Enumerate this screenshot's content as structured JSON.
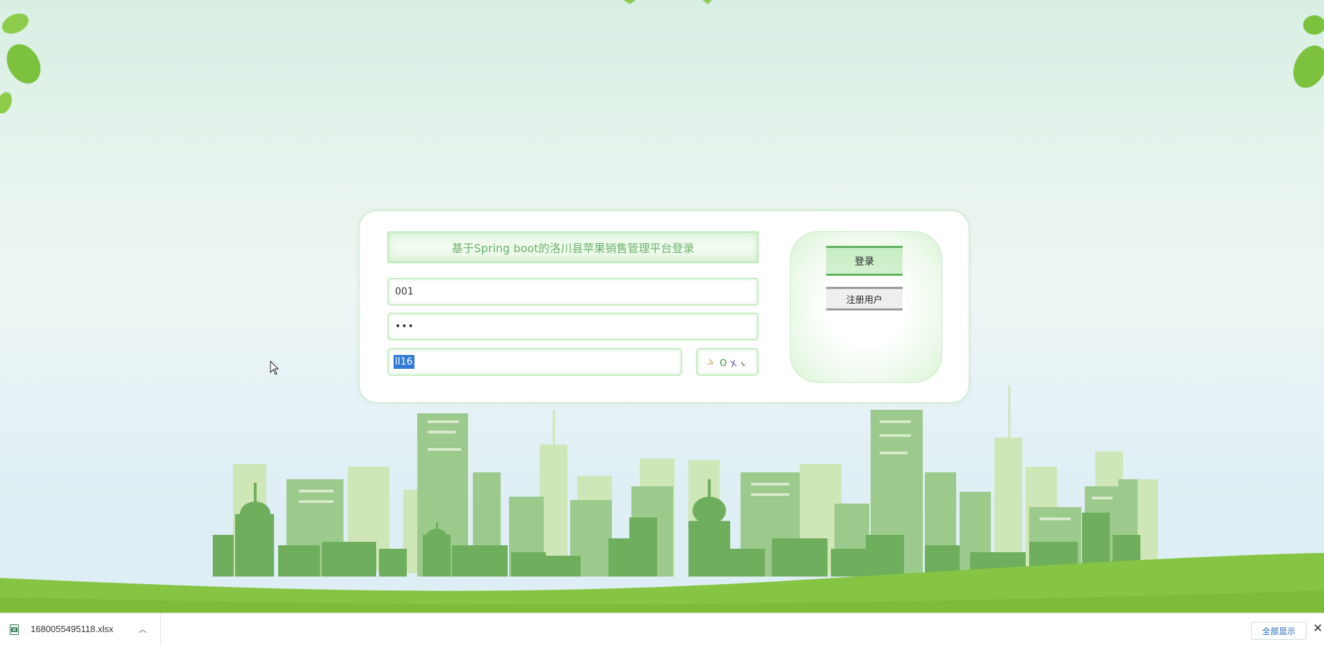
{
  "login": {
    "title": "基于Spring boot的洛川县苹果销售管理平台登录",
    "username_value": "001",
    "password_value": "•••",
    "captcha_value": "ll16",
    "captcha_glyphs": [
      "ᐳ",
      "O",
      "X",
      "ι"
    ],
    "login_button": "登录",
    "register_button": "注册用户"
  },
  "download_bar": {
    "file_name": "1680055495118.xlsx",
    "show_all_label": "全部显示"
  },
  "icons": {
    "file": "excel-file-icon",
    "chevron": "chevron-up-icon",
    "close": "close-icon",
    "cursor": "mouse-pointer-icon"
  },
  "colors": {
    "accent_green": "#5bb35b",
    "title_text": "#6ab06a",
    "link_blue": "#1a63c9"
  }
}
